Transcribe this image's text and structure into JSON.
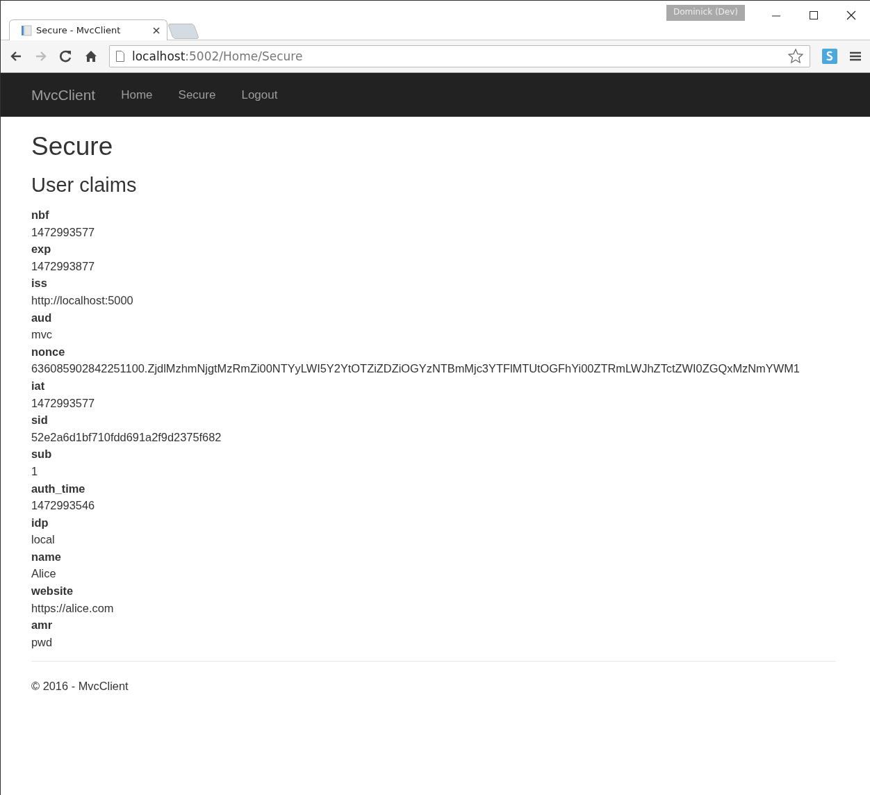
{
  "browser": {
    "profile": "Dominick (Dev)",
    "tabs": [
      {
        "title": "Secure - MvcClient",
        "selected": true
      }
    ],
    "address": {
      "host": "localhost",
      "path": ":5002/Home/Secure"
    }
  },
  "navbar": {
    "brand": "MvcClient",
    "links": [
      "Home",
      "Secure",
      "Logout"
    ]
  },
  "page": {
    "title": "Secure",
    "subtitle": "User claims",
    "claims": [
      {
        "type": "nbf",
        "value": "1472993577"
      },
      {
        "type": "exp",
        "value": "1472993877"
      },
      {
        "type": "iss",
        "value": "http://localhost:5000"
      },
      {
        "type": "aud",
        "value": "mvc"
      },
      {
        "type": "nonce",
        "value": "636085902842251100.ZjdlMzhmNjgtMzRmZi00NTYyLWI5Y2YtOTZiZDZiOGYzNTBmMjc3YTFlMTUtOGFhYi00ZTRmLWJhZTctZWI0ZGQxMzNmYWM1"
      },
      {
        "type": "iat",
        "value": "1472993577"
      },
      {
        "type": "sid",
        "value": "52e2a6d1bf710fdd691a2f9d2375f682"
      },
      {
        "type": "sub",
        "value": "1"
      },
      {
        "type": "auth_time",
        "value": "1472993546"
      },
      {
        "type": "idp",
        "value": "local"
      },
      {
        "type": "name",
        "value": "Alice"
      },
      {
        "type": "website",
        "value": "https://alice.com"
      },
      {
        "type": "amr",
        "value": "pwd"
      }
    ]
  },
  "footer": "© 2016 - MvcClient"
}
